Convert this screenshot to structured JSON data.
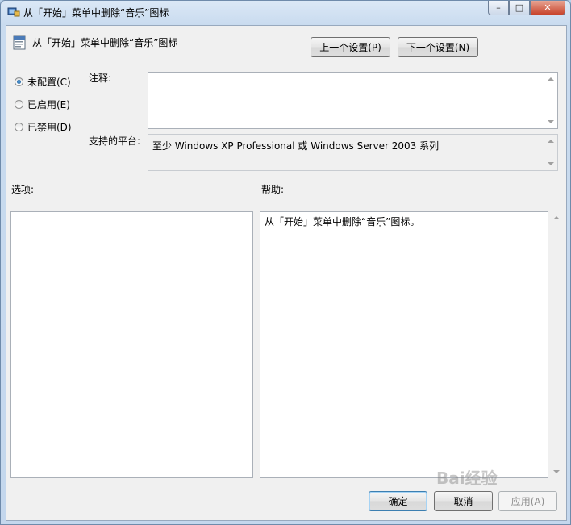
{
  "window": {
    "title": "从「开始」菜单中删除“音乐”图标",
    "caption_buttons": {
      "minimize": "–",
      "maximize": "□",
      "close": "✕"
    }
  },
  "header": {
    "policy_title": "从「开始」菜单中删除“音乐”图标",
    "prev_setting": "上一个设置(P)",
    "next_setting": "下一个设置(N)"
  },
  "state_options": [
    {
      "label": "未配置(C)",
      "checked": true
    },
    {
      "label": "已启用(E)",
      "checked": false
    },
    {
      "label": "已禁用(D)",
      "checked": false
    }
  ],
  "comment": {
    "label": "注释:",
    "value": ""
  },
  "platform": {
    "label": "支持的平台:",
    "value": "至少 Windows XP Professional 或 Windows Server 2003 系列"
  },
  "options": {
    "label": "选项:"
  },
  "help": {
    "label": "帮助:",
    "text": "从「开始」菜单中删除“音乐”图标。"
  },
  "footer": {
    "ok": "确定",
    "cancel": "取消",
    "apply": "应用(A)"
  },
  "watermark": "Bai经验"
}
